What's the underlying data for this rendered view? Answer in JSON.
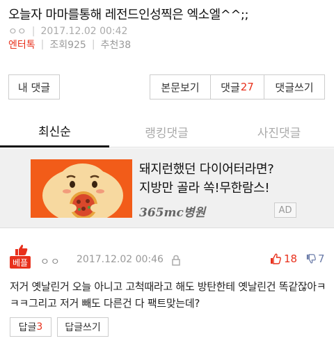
{
  "post": {
    "title": "오늘자 마마를통해 레전드인성찍은 엑소엘^^;;",
    "user": "ㅇㅇ",
    "date": "2017.12.02 00:42",
    "category": "엔터톡",
    "views": "조회925",
    "recommends": "추천38"
  },
  "actions": {
    "my_comments": "내 댓글",
    "view_body": "본문보기",
    "comments_label": "댓글",
    "comments_count": "27",
    "write_comment": "댓글쓰기"
  },
  "tabs": [
    {
      "label": "최신순",
      "active": true
    },
    {
      "label": "랭킹댓글",
      "active": false
    },
    {
      "label": "사진댓글",
      "active": false
    }
  ],
  "ad": {
    "line1": "돼지런했던 다이어터라면?",
    "line2": "지방만 골라 쏙!무한람스!",
    "brand": "365mc병원",
    "badge": "AD"
  },
  "comment": {
    "badge": "베플",
    "user": "ㅇㅇ",
    "date": "2017.12.02 00:46",
    "upvotes": "18",
    "downvotes": "7",
    "body": "저거 옛날린거 오늘 아니고 고척때라고 해도 방탄한테 옛날린건 똑같잖아ㅋㅋㅋ그리고 저거 빼도 다른건 다 팩트맞는데?",
    "reply_label": "답글",
    "reply_count": "3",
    "write_reply": "답글쓰기"
  },
  "colors": {
    "accent": "#e8301c",
    "down": "#6a7ba8",
    "ad_bg": "#f25c19"
  }
}
